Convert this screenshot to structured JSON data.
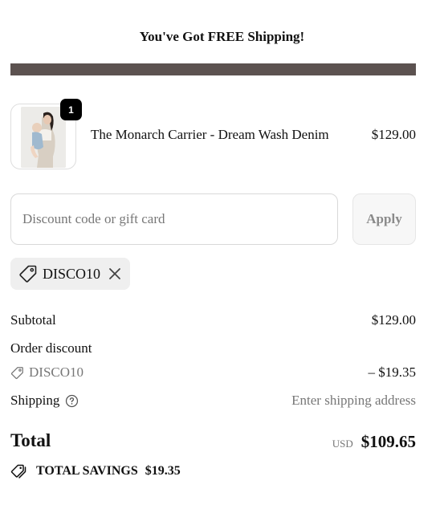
{
  "banner": {
    "text": "You've Got FREE Shipping!"
  },
  "progress": {
    "fill_fraction": 1.0,
    "track_color": "#e9e4e2",
    "fill_color": "#5c5250"
  },
  "cart": {
    "items": [
      {
        "title": "The Monarch Carrier - Dream Wash Denim",
        "price": "$129.00",
        "quantity": "1"
      }
    ]
  },
  "discount": {
    "placeholder": "Discount code or gift card",
    "value": "",
    "apply_label": "Apply",
    "applied_code": "DISCO10"
  },
  "summary": {
    "subtotal_label": "Subtotal",
    "subtotal_value": "$129.00",
    "order_discount_label": "Order discount",
    "discount_code": "DISCO10",
    "discount_value": "– $19.35",
    "shipping_label": "Shipping",
    "shipping_value": "Enter shipping address",
    "total_label": "Total",
    "currency": "USD",
    "total_value": "$109.65",
    "savings_label": "TOTAL SAVINGS",
    "savings_value": "$19.35"
  },
  "icons": {
    "tag": "tag-icon",
    "close": "close-icon",
    "help": "question-circle-icon",
    "savings": "tags-icon"
  }
}
